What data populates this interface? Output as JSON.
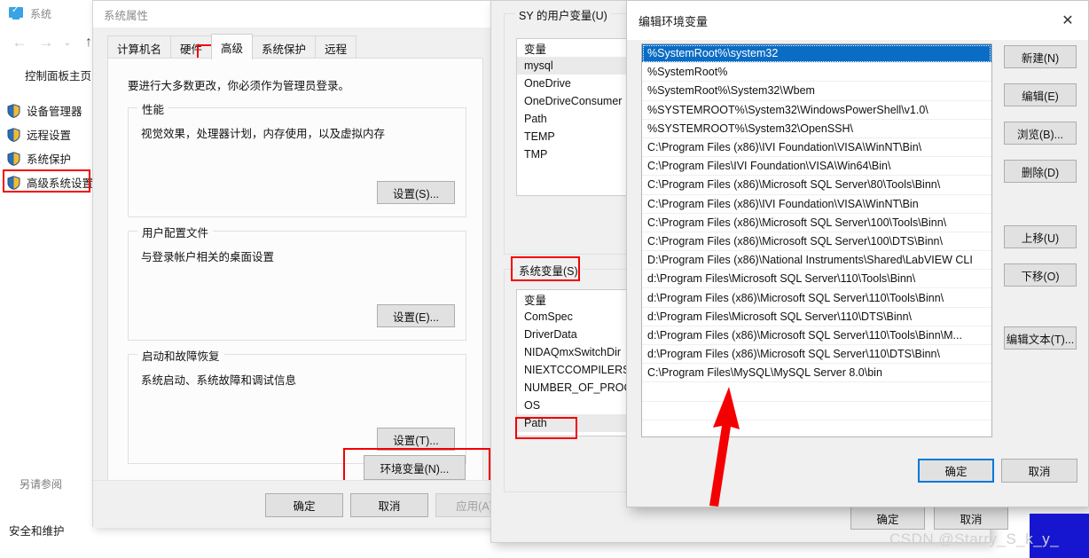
{
  "control_panel": {
    "window_title": "系统",
    "system_icon": "monitor-check-icon",
    "nav": {
      "back": "←",
      "forward": "→",
      "recent": "⌄",
      "up": "↑"
    },
    "home_link": "控制面板主页",
    "links": [
      {
        "label": "设备管理器",
        "icon": "shield-icon"
      },
      {
        "label": "远程设置",
        "icon": "shield-icon"
      },
      {
        "label": "系统保护",
        "icon": "shield-icon"
      },
      {
        "label": "高级系统设置",
        "icon": "shield-icon",
        "highlighted": true
      }
    ],
    "see_also_label": "另请参阅",
    "see_also_link": "安全和维护"
  },
  "system_properties": {
    "title": "系统属性",
    "tabs": [
      {
        "label": "计算机名",
        "active": false
      },
      {
        "label": "硬件",
        "active": false
      },
      {
        "label": "高级",
        "active": true,
        "highlighted": true
      },
      {
        "label": "系统保护",
        "active": false
      },
      {
        "label": "远程",
        "active": false
      }
    ],
    "admin_note": "要进行大多数更改，你必须作为管理员登录。",
    "groups": [
      {
        "label": "性能",
        "desc": "视觉效果，处理器计划，内存使用，以及虚拟内存",
        "button": "设置(S)..."
      },
      {
        "label": "用户配置文件",
        "desc": "与登录帐户相关的桌面设置",
        "button": "设置(E)..."
      },
      {
        "label": "启动和故障恢复",
        "desc": "系统启动、系统故障和调试信息",
        "button": "设置(T)..."
      }
    ],
    "env_button": "环境变量(N)...",
    "footer_buttons": [
      {
        "label": "确定",
        "disabled": false
      },
      {
        "label": "取消",
        "disabled": false
      },
      {
        "label": "应用(A)",
        "disabled": true
      }
    ]
  },
  "environment_variables": {
    "user_group_label": "SY 的用户变量(U)",
    "user_column_header": "变量",
    "user_vars": [
      {
        "name": "mysql",
        "selected": true
      },
      {
        "name": "OneDrive",
        "selected": false
      },
      {
        "name": "OneDriveConsumer",
        "selected": false
      },
      {
        "name": "Path",
        "selected": false
      },
      {
        "name": "TEMP",
        "selected": false
      },
      {
        "name": "TMP",
        "selected": false
      }
    ],
    "system_group_label": "系统变量(S)",
    "system_column_header": "变量",
    "system_vars": [
      {
        "name": "ComSpec",
        "selected": false
      },
      {
        "name": "DriverData",
        "selected": false
      },
      {
        "name": "NIDAQmxSwitchDir",
        "selected": false
      },
      {
        "name": "NIEXTCCOMPILERSU",
        "selected": false
      },
      {
        "name": "NUMBER_OF_PROCE",
        "selected": false
      },
      {
        "name": "OS",
        "selected": false
      },
      {
        "name": "Path",
        "selected": true,
        "highlighted": true
      }
    ],
    "footer_buttons": [
      {
        "label": "确定"
      },
      {
        "label": "取消"
      }
    ]
  },
  "edit_environment_variable": {
    "title": "编辑环境变量",
    "close_icon": "close-icon",
    "path_entries": [
      {
        "value": "%SystemRoot%\\system32",
        "selected": true
      },
      {
        "value": "%SystemRoot%",
        "selected": false
      },
      {
        "value": "%SystemRoot%\\System32\\Wbem",
        "selected": false
      },
      {
        "value": "%SYSTEMROOT%\\System32\\WindowsPowerShell\\v1.0\\",
        "selected": false
      },
      {
        "value": "%SYSTEMROOT%\\System32\\OpenSSH\\",
        "selected": false
      },
      {
        "value": "C:\\Program Files (x86)\\IVI Foundation\\VISA\\WinNT\\Bin\\",
        "selected": false
      },
      {
        "value": "C:\\Program Files\\IVI Foundation\\VISA\\Win64\\Bin\\",
        "selected": false
      },
      {
        "value": "C:\\Program Files (x86)\\Microsoft SQL Server\\80\\Tools\\Binn\\",
        "selected": false
      },
      {
        "value": "C:\\Program Files (x86)\\IVI Foundation\\VISA\\WinNT\\Bin",
        "selected": false
      },
      {
        "value": "C:\\Program Files (x86)\\Microsoft SQL Server\\100\\Tools\\Binn\\",
        "selected": false
      },
      {
        "value": "C:\\Program Files (x86)\\Microsoft SQL Server\\100\\DTS\\Binn\\",
        "selected": false
      },
      {
        "value": "D:\\Program Files (x86)\\National Instruments\\Shared\\LabVIEW CLI",
        "selected": false
      },
      {
        "value": "d:\\Program Files\\Microsoft SQL Server\\110\\Tools\\Binn\\",
        "selected": false
      },
      {
        "value": "d:\\Program Files (x86)\\Microsoft SQL Server\\110\\Tools\\Binn\\",
        "selected": false
      },
      {
        "value": "d:\\Program Files\\Microsoft SQL Server\\110\\DTS\\Binn\\",
        "selected": false
      },
      {
        "value": "d:\\Program Files (x86)\\Microsoft SQL Server\\110\\Tools\\Binn\\M...",
        "selected": false
      },
      {
        "value": "d:\\Program Files (x86)\\Microsoft SQL Server\\110\\DTS\\Binn\\",
        "selected": false
      },
      {
        "value": "C:\\Program Files\\MySQL\\MySQL Server 8.0\\bin",
        "selected": false,
        "highlighted": true
      },
      {
        "value": "",
        "selected": false
      },
      {
        "value": "",
        "selected": false
      },
      {
        "value": "",
        "selected": false
      }
    ],
    "side_buttons": [
      {
        "label": "新建(N)"
      },
      {
        "label": "编辑(E)"
      },
      {
        "label": "浏览(B)..."
      },
      {
        "label": "删除(D)"
      },
      {
        "label": "上移(U)"
      },
      {
        "label": "下移(O)"
      },
      {
        "label": "编辑文本(T)..."
      }
    ],
    "footer_buttons": [
      {
        "label": "确定",
        "default": true
      },
      {
        "label": "取消",
        "default": false
      }
    ]
  },
  "annotations": {
    "highlight_color": "#f50000",
    "arrow_color": "#f50000",
    "watermark": "CSDN @Starry_S_k_y_"
  }
}
